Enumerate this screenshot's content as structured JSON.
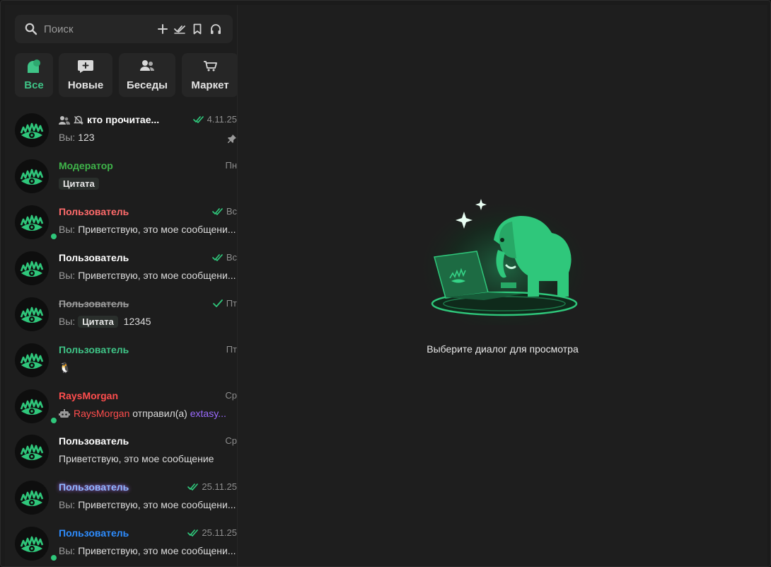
{
  "search": {
    "placeholder": "Поиск",
    "actions": [
      "plus-icon",
      "double-check-icon",
      "bookmark-icon",
      "headphones-icon"
    ]
  },
  "tabs": [
    {
      "label": "Все",
      "icon": "chats-icon",
      "active": true
    },
    {
      "label": "Новые",
      "icon": "new-message-icon",
      "active": false
    },
    {
      "label": "Беседы",
      "icon": "group-icon",
      "active": false
    },
    {
      "label": "Маркет",
      "icon": "cart-icon",
      "active": false
    }
  ],
  "chats": [
    {
      "name": "кто прочитае...",
      "time": "4.11.25",
      "you": "Вы:",
      "text": "123",
      "name_color": "#ffffff",
      "read": true,
      "pinned": true,
      "online": false,
      "group": true,
      "muted": true
    },
    {
      "name": "Модератор",
      "time": "Пн",
      "chip": "Цитата",
      "name_color": "#3fb54a",
      "read": false,
      "online": false
    },
    {
      "name": "Пользователь",
      "time": "Вс",
      "you": "Вы:",
      "text": "Приветствую, это мое сообщени...",
      "name_color": "#ff6b6b",
      "read": true,
      "online": true
    },
    {
      "name": "Пользователь",
      "time": "Вс",
      "you": "Вы:",
      "text": "Приветствую, это мое сообщени...",
      "name_color": "#ffffff",
      "read": true,
      "online": false
    },
    {
      "name": "Пользователь",
      "time": "Пт",
      "you": "Вы:",
      "chip": "Цитата",
      "text": "12345",
      "name_color": "#9a9a9a",
      "read": true,
      "single_check": true,
      "online": false,
      "strike": true
    },
    {
      "name": "Пользователь",
      "time": "Пт",
      "text": "🐧",
      "name_color": "#3fc487",
      "read": false,
      "online": false
    },
    {
      "name": "RaysMorgan",
      "time": "Ср",
      "bot_line": {
        "sender": "RaysMorgan",
        "action": "отправил(а)",
        "target": "extasy..."
      },
      "name_color": "#ff4d4d",
      "read": false,
      "online": true
    },
    {
      "name": "Пользователь",
      "time": "Ср",
      "text": "Приветствую, это мое сообщение",
      "name_color": "#ffffff",
      "read": false,
      "online": false
    },
    {
      "name": "Пользователь",
      "time": "25.11.25",
      "you": "Вы:",
      "text": "Приветствую, это мое сообщени...",
      "name_color": "#8fb7ff",
      "read": true,
      "online": false
    },
    {
      "name": "Пользователь",
      "time": "25.11.25",
      "you": "Вы:",
      "text": "Приветствую, это мое сообщени...",
      "name_color": "#2e8dff",
      "read": true,
      "online": true
    }
  ],
  "empty_state": {
    "text": "Выберите диалог для просмотра",
    "illustration": "elephant-with-laptop"
  },
  "colors": {
    "accent": "#3fc487",
    "background": "#1d1d1d"
  }
}
